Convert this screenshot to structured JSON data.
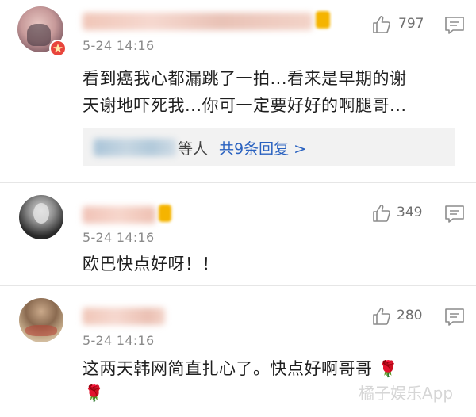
{
  "comments": [
    {
      "time": "5-24 14:16",
      "text_line1": "看到癌我心都漏跳了一拍...看来是早期的谢",
      "text_line2": "天谢地吓死我...你可一定要好好的啊腿哥...",
      "likes": "797",
      "replies_suffix": "等人",
      "replies_link": "共9条回复 >"
    },
    {
      "time": "5-24 14:16",
      "text_line1": "欧巴快点好呀！！",
      "likes": "349"
    },
    {
      "time": "5-24 14:16",
      "text_line1": "这两天韩网简直扎心了。快点好啊哥哥",
      "likes": "280"
    }
  ],
  "icons": {
    "like": "thumbs-up-icon",
    "comment": "comment-icon",
    "rose": "🌹"
  },
  "watermark": "橘子娱乐App",
  "colors": {
    "link": "#2a62c0",
    "time": "#8a8a8a",
    "badge": "#e8453c",
    "vip": "#f5b400"
  }
}
